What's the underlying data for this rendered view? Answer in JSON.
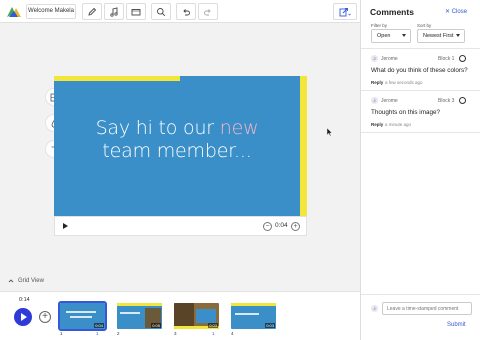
{
  "colors": {
    "accent": "#3458d8",
    "slide_bg": "#3a8fc8",
    "slide_accent": "#f3e63a",
    "highlight": "#f4b6c8",
    "play_button": "#2f3bd6"
  },
  "toolbar": {
    "title": "Welcome Makela",
    "tools": [
      "pencil-icon",
      "music-note-icon",
      "screen-icon",
      "search-icon",
      "undo-icon",
      "redo-icon"
    ],
    "export_icon": "share-export-icon"
  },
  "side_tools": [
    "layout-icon",
    "color-drop-icon",
    "text-icon"
  ],
  "slide": {
    "line1_a": "Say hi to our ",
    "line1_b": "new",
    "line2": "team member..."
  },
  "player": {
    "time": "0:04"
  },
  "grid_view": {
    "label": "Grid View"
  },
  "timeline": {
    "current_time": "0:14",
    "thumbnails": [
      {
        "number": "1",
        "duration": "0:04",
        "comments": "1",
        "selected": true
      },
      {
        "number": "2",
        "duration": "0:05",
        "comments": "",
        "selected": false
      },
      {
        "number": "3",
        "duration": "0:03",
        "comments": "1",
        "selected": false
      },
      {
        "number": "4",
        "duration": "0:03",
        "comments": "",
        "selected": false
      }
    ]
  },
  "comments_panel": {
    "title": "Comments",
    "close_label": "Close",
    "filter_label": "Filter by",
    "filter_value": "Open",
    "sort_label": "Sort by",
    "sort_value": "Newest First",
    "comments": [
      {
        "avatar": "J",
        "author": "Jerome",
        "block": "Block 1",
        "text": "What do you think of these colors?",
        "reply": "Reply",
        "time": "a few seconds ago"
      },
      {
        "avatar": "J",
        "author": "Jerome",
        "block": "Block 3",
        "text": "Thoughts on this image?",
        "reply": "Reply",
        "time": "a minute ago"
      }
    ],
    "input_avatar": "J",
    "input_placeholder": "Leave a time-stamped comment",
    "submit_label": "Submit"
  }
}
